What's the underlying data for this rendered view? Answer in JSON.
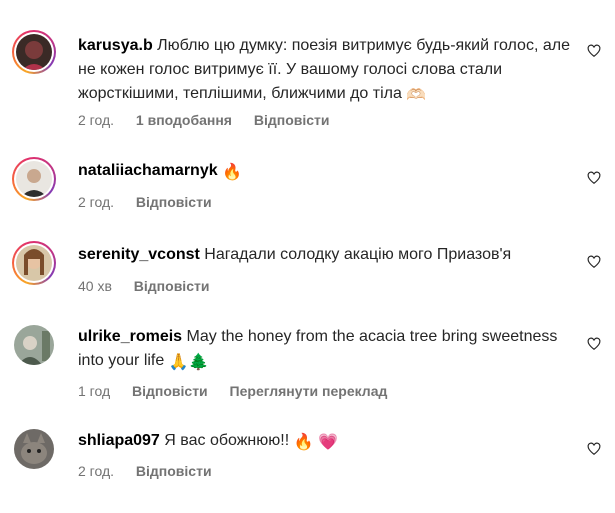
{
  "comments": [
    {
      "username": "karusya.b",
      "text": "Люблю цю думку: поезія витримує будь-який голос, але не кожен голос витримує її. У вашому голосі слова стали жорсткішими, теплішими, ближчими до тіла",
      "emoji": "🫶🏻",
      "time": "2 год.",
      "likes": "1 вподобання",
      "reply": "Відповісти"
    },
    {
      "username": "nataliiachamarnyk",
      "text": "",
      "emoji": "🔥",
      "time": "2 год.",
      "reply": "Відповісти"
    },
    {
      "username": "serenity_vconst",
      "text": "Нагадали солодку акацію мого Приазов'я",
      "time": "40 хв",
      "reply": "Відповісти"
    },
    {
      "username": "ulrike_romeis",
      "text": "May the honey from the acacia tree bring sweetness into your life",
      "emoji": "🙏🌲",
      "time": "1 год",
      "reply": "Відповісти",
      "translate": "Переглянути переклад"
    },
    {
      "username": "shliapa097",
      "text": "Я вас обожнюю!!",
      "emoji": "🔥 💗",
      "time": "2 год.",
      "reply": "Відповісти"
    }
  ],
  "colors": {
    "accent": "#e1306c",
    "muted": "#737373",
    "text": "#262626"
  },
  "icons": {
    "like": "heart-outline-icon"
  }
}
